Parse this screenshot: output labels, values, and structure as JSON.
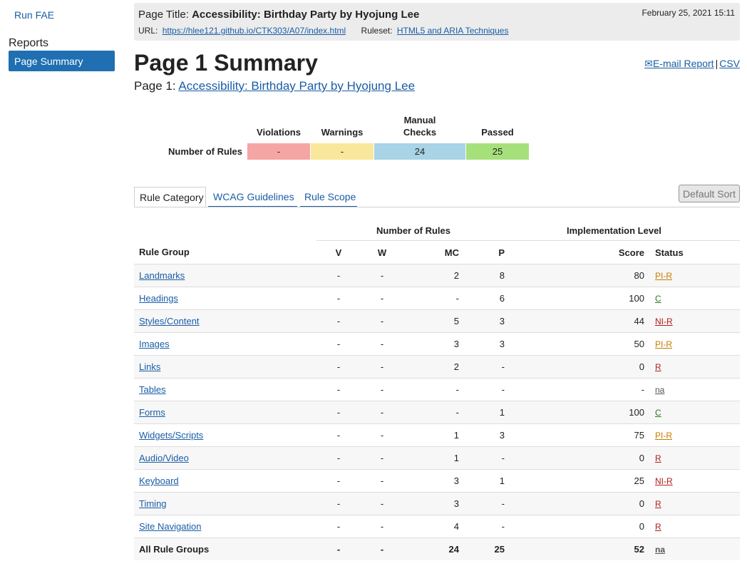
{
  "sidebar": {
    "run_fae": "Run FAE",
    "reports_heading": "Reports",
    "page_summary": "Page Summary"
  },
  "header": {
    "page_title_label": "Page Title:",
    "page_title": "Accessibility: Birthday Party by Hyojung Lee",
    "date": "February 25, 2021 15:11",
    "url_label": "URL:",
    "url": "https://hlee121.github.io/CTK303/A07/index.html",
    "ruleset_label": "Ruleset:",
    "ruleset": "HTML5 and ARIA Techniques"
  },
  "summary": {
    "title": "Page 1 Summary",
    "page_label": "Page 1:",
    "page_link": "Accessibility: Birthday Party by Hyojung Lee",
    "email_report": "E-mail Report",
    "csv": "CSV",
    "separator": "|"
  },
  "counts": {
    "row_label": "Number of Rules",
    "headers": [
      "Violations",
      "Warnings",
      "Manual Checks",
      "Passed"
    ],
    "values": [
      "-",
      "-",
      "24",
      "25"
    ]
  },
  "tabs": [
    "Rule Category",
    "WCAG Guidelines",
    "Rule Scope"
  ],
  "default_sort": "Default Sort",
  "rules_table": {
    "group_headers": {
      "number_of_rules": "Number of Rules",
      "implementation_level": "Implementation Level"
    },
    "columns": {
      "group": "Rule Group",
      "v": "V",
      "w": "W",
      "mc": "MC",
      "p": "P",
      "score": "Score",
      "status": "Status"
    },
    "rows": [
      {
        "group": "Landmarks",
        "v": "-",
        "w": "-",
        "mc": "2",
        "p": "8",
        "score": "80",
        "status": "PI-R"
      },
      {
        "group": "Headings",
        "v": "-",
        "w": "-",
        "mc": "-",
        "p": "6",
        "score": "100",
        "status": "C"
      },
      {
        "group": "Styles/Content",
        "v": "-",
        "w": "-",
        "mc": "5",
        "p": "3",
        "score": "44",
        "status": "NI-R"
      },
      {
        "group": "Images",
        "v": "-",
        "w": "-",
        "mc": "3",
        "p": "3",
        "score": "50",
        "status": "PI-R"
      },
      {
        "group": "Links",
        "v": "-",
        "w": "-",
        "mc": "2",
        "p": "-",
        "score": "0",
        "status": "R"
      },
      {
        "group": "Tables",
        "v": "-",
        "w": "-",
        "mc": "-",
        "p": "-",
        "score": "-",
        "status": "na"
      },
      {
        "group": "Forms",
        "v": "-",
        "w": "-",
        "mc": "-",
        "p": "1",
        "score": "100",
        "status": "C"
      },
      {
        "group": "Widgets/Scripts",
        "v": "-",
        "w": "-",
        "mc": "1",
        "p": "3",
        "score": "75",
        "status": "PI-R"
      },
      {
        "group": "Audio/Video",
        "v": "-",
        "w": "-",
        "mc": "1",
        "p": "-",
        "score": "0",
        "status": "R"
      },
      {
        "group": "Keyboard",
        "v": "-",
        "w": "-",
        "mc": "3",
        "p": "1",
        "score": "25",
        "status": "NI-R"
      },
      {
        "group": "Timing",
        "v": "-",
        "w": "-",
        "mc": "3",
        "p": "-",
        "score": "0",
        "status": "R"
      },
      {
        "group": "Site Navigation",
        "v": "-",
        "w": "-",
        "mc": "4",
        "p": "-",
        "score": "0",
        "status": "R"
      }
    ],
    "total": {
      "group": "All Rule Groups",
      "v": "-",
      "w": "-",
      "mc": "24",
      "p": "25",
      "score": "52",
      "status": "na"
    }
  },
  "colors": {
    "link": "#1a5da6",
    "nav_active": "#1f6fb2",
    "violations": "#f6a5a5",
    "warnings": "#f9e79b",
    "manual": "#a9d3e6",
    "passed": "#a6e07b",
    "status_partial": "#c57a00",
    "status_complete": "#2c7a1e",
    "status_required": "#b01c1c"
  }
}
